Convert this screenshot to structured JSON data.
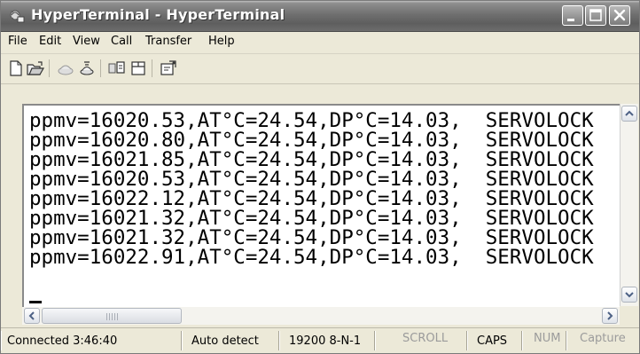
{
  "window": {
    "title": "HyperTerminal - HyperTerminal",
    "titlebar_color": "#6f6f6f"
  },
  "menu": {
    "items": [
      "File",
      "Edit",
      "View",
      "Call",
      "Transfer",
      "Help"
    ]
  },
  "toolbar": {
    "icons": [
      "new-icon",
      "open-icon",
      "connect-icon",
      "disconnect-icon",
      "send-icon",
      "receive-icon",
      "properties-icon"
    ]
  },
  "terminal": {
    "lines": [
      "ppmv=16020.53,AT°C=24.54,DP°C=14.03,  SERVOLOCK",
      "ppmv=16020.80,AT°C=24.54,DP°C=14.03,  SERVOLOCK",
      "ppmv=16021.85,AT°C=24.54,DP°C=14.03,  SERVOLOCK",
      "ppmv=16020.53,AT°C=24.54,DP°C=14.03,  SERVOLOCK",
      "ppmv=16022.12,AT°C=24.54,DP°C=14.03,  SERVOLOCK",
      "ppmv=16021.32,AT°C=24.54,DP°C=14.03,  SERVOLOCK",
      "ppmv=16021.32,AT°C=24.54,DP°C=14.03,  SERVOLOCK",
      "ppmv=16022.91,AT°C=24.54,DP°C=14.03,  SERVOLOCK"
    ]
  },
  "statusbar": {
    "connection": "Connected 3:46:40",
    "detect": "Auto detect",
    "settings": "19200 8-N-1",
    "scroll": "SCROLL",
    "caps": "CAPS",
    "num": "NUM",
    "capture": "Capture"
  }
}
